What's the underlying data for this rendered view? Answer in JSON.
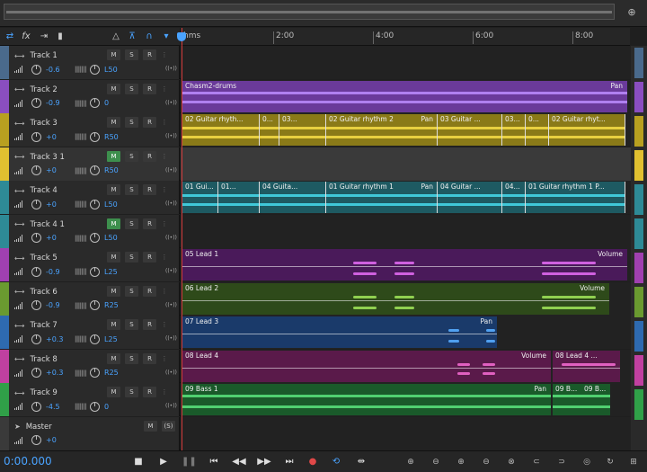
{
  "toolbar": {
    "icons": [
      "loop-switch-icon",
      "fx-icon",
      "sends-icon",
      "eq-bars-icon",
      "metronome-icon",
      "ruler-icon",
      "headphones-icon",
      "pin-icon"
    ]
  },
  "ruler": {
    "unit": "hms",
    "ticks": [
      "2:00",
      "4:00",
      "6:00",
      "8:00"
    ]
  },
  "tracks": [
    {
      "name": "Track 1",
      "vol": "-0.6",
      "pan": "L50",
      "color": "#4a6a8c",
      "m": "M",
      "s": "S",
      "r": "R"
    },
    {
      "name": "Track 2",
      "vol": "-0.9",
      "pan": "0",
      "color": "#8a4ec0",
      "m": "M",
      "s": "S",
      "r": "R"
    },
    {
      "name": "Track 3",
      "vol": "+0",
      "pan": "R50",
      "color": "#b8a020",
      "m": "M",
      "s": "S",
      "r": "R"
    },
    {
      "name": "Track 3 1",
      "vol": "+0",
      "pan": "R50",
      "color": "#e0c030",
      "m": "M",
      "s": "S",
      "r": "R"
    },
    {
      "name": "Track 4",
      "vol": "+0",
      "pan": "L50",
      "color": "#2e8a96",
      "m": "M",
      "s": "S",
      "r": "R"
    },
    {
      "name": "Track 4 1",
      "vol": "+0",
      "pan": "L50",
      "color": "#2e8a96",
      "m": "M",
      "s": "S",
      "r": "R"
    },
    {
      "name": "Track 5",
      "vol": "-0.9",
      "pan": "L25",
      "color": "#a040b0",
      "m": "M",
      "s": "S",
      "r": "R"
    },
    {
      "name": "Track 6",
      "vol": "-0.9",
      "pan": "R25",
      "color": "#6a9a30",
      "m": "M",
      "s": "S",
      "r": "R"
    },
    {
      "name": "Track 7",
      "vol": "+0.3",
      "pan": "L25",
      "color": "#2e6ab0",
      "m": "M",
      "s": "S",
      "r": "R"
    },
    {
      "name": "Track 8",
      "vol": "+0.3",
      "pan": "R25",
      "color": "#c040a0",
      "m": "M",
      "s": "S",
      "r": "R"
    },
    {
      "name": "Track 9",
      "vol": "-4.5",
      "pan": "0",
      "color": "#30a048",
      "m": "M",
      "s": "S",
      "r": "R"
    }
  ],
  "master": {
    "name": "Master",
    "vol": "+0",
    "m": "M",
    "s": "(S)"
  },
  "clips": {
    "t2": {
      "title": "Chasm2-drums",
      "fx": "Pan"
    },
    "t3": [
      "02 Guitar rhyth...",
      "0...",
      "03...",
      "02 Guitar rhythm 2",
      "03 Guitar ...",
      "03...",
      "0...",
      "02 Guitar rhyt..."
    ],
    "t3_fx": "Pan",
    "t4": [
      "01 Gui...",
      "01...",
      "04 Guita...",
      "01 Guitar rhythm 1",
      "04 Guitar ...",
      "04...",
      "01 Guitar rhythm 1 P..."
    ],
    "t4_fx": "Pan",
    "t5": {
      "title": "05 Lead 1",
      "fx": "Volume"
    },
    "t6": {
      "title": "06 Lead 2",
      "fx": "Volume"
    },
    "t7": {
      "title": "07 Lead 3",
      "fx": "Pan"
    },
    "t8": {
      "title": "08 Lead 4",
      "fx": "Volume",
      "title2": "08 Lead 4 ..."
    },
    "t9": {
      "title": "09 Bass 1",
      "fx": "Pan",
      "title2": "09 B...",
      "title3": "09 B..."
    }
  },
  "transport": {
    "timecode": "0:00.000"
  }
}
